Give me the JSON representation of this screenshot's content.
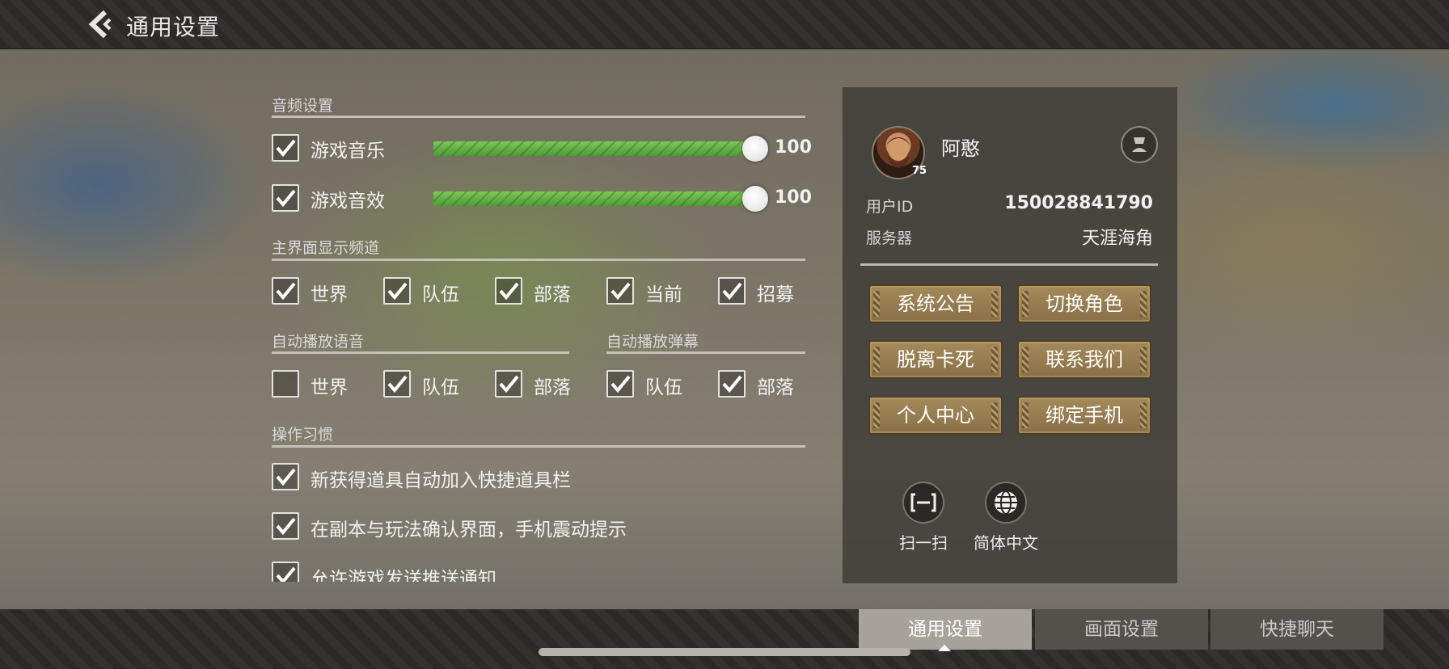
{
  "header": {
    "title": "通用设置"
  },
  "audio": {
    "section_title": "音频设置",
    "items": [
      {
        "label": "游戏音乐",
        "checked": true,
        "value": 100,
        "display": "100"
      },
      {
        "label": "游戏音效",
        "checked": true,
        "value": 100,
        "display": "100"
      }
    ]
  },
  "channels": {
    "section_title": "主界面显示频道",
    "items": [
      {
        "label": "世界",
        "checked": true
      },
      {
        "label": "队伍",
        "checked": true
      },
      {
        "label": "部落",
        "checked": true
      },
      {
        "label": "当前",
        "checked": true
      },
      {
        "label": "招募",
        "checked": true
      }
    ]
  },
  "auto_voice": {
    "section_title": "自动播放语音",
    "items": [
      {
        "label": "世界",
        "checked": false
      },
      {
        "label": "队伍",
        "checked": true
      },
      {
        "label": "部落",
        "checked": true
      }
    ]
  },
  "auto_danmaku": {
    "section_title": "自动播放弹幕",
    "items": [
      {
        "label": "队伍",
        "checked": true
      },
      {
        "label": "部落",
        "checked": true
      }
    ]
  },
  "habits": {
    "section_title": "操作习惯",
    "items": [
      {
        "label": "新获得道具自动加入快捷道具栏",
        "checked": true
      },
      {
        "label": "在副本与玩法确认界面，手机震动提示",
        "checked": true
      },
      {
        "label": "允许游戏发送推送通知",
        "checked": true
      }
    ]
  },
  "profile": {
    "name": "阿憨",
    "level": "75",
    "user_id_label": "用户ID",
    "user_id": "150028841790",
    "server_label": "服务器",
    "server": "天涯海角",
    "buttons": [
      "系统公告",
      "切换角色",
      "脱离卡死",
      "联系我们",
      "个人中心",
      "绑定手机"
    ],
    "scan_label": "扫一扫",
    "language_label": "简体中文",
    "icons": {
      "profile": "character-card-icon",
      "scan": "scan-icon",
      "language": "globe-icon"
    }
  },
  "tabs": [
    {
      "label": "通用设置",
      "active": true
    },
    {
      "label": "画面设置",
      "active": false
    },
    {
      "label": "快捷聊天",
      "active": false
    }
  ],
  "colors": {
    "slider_fill": "#6ab84a",
    "button_gold": "#9a8050",
    "active_tab": "#a7a39a"
  }
}
